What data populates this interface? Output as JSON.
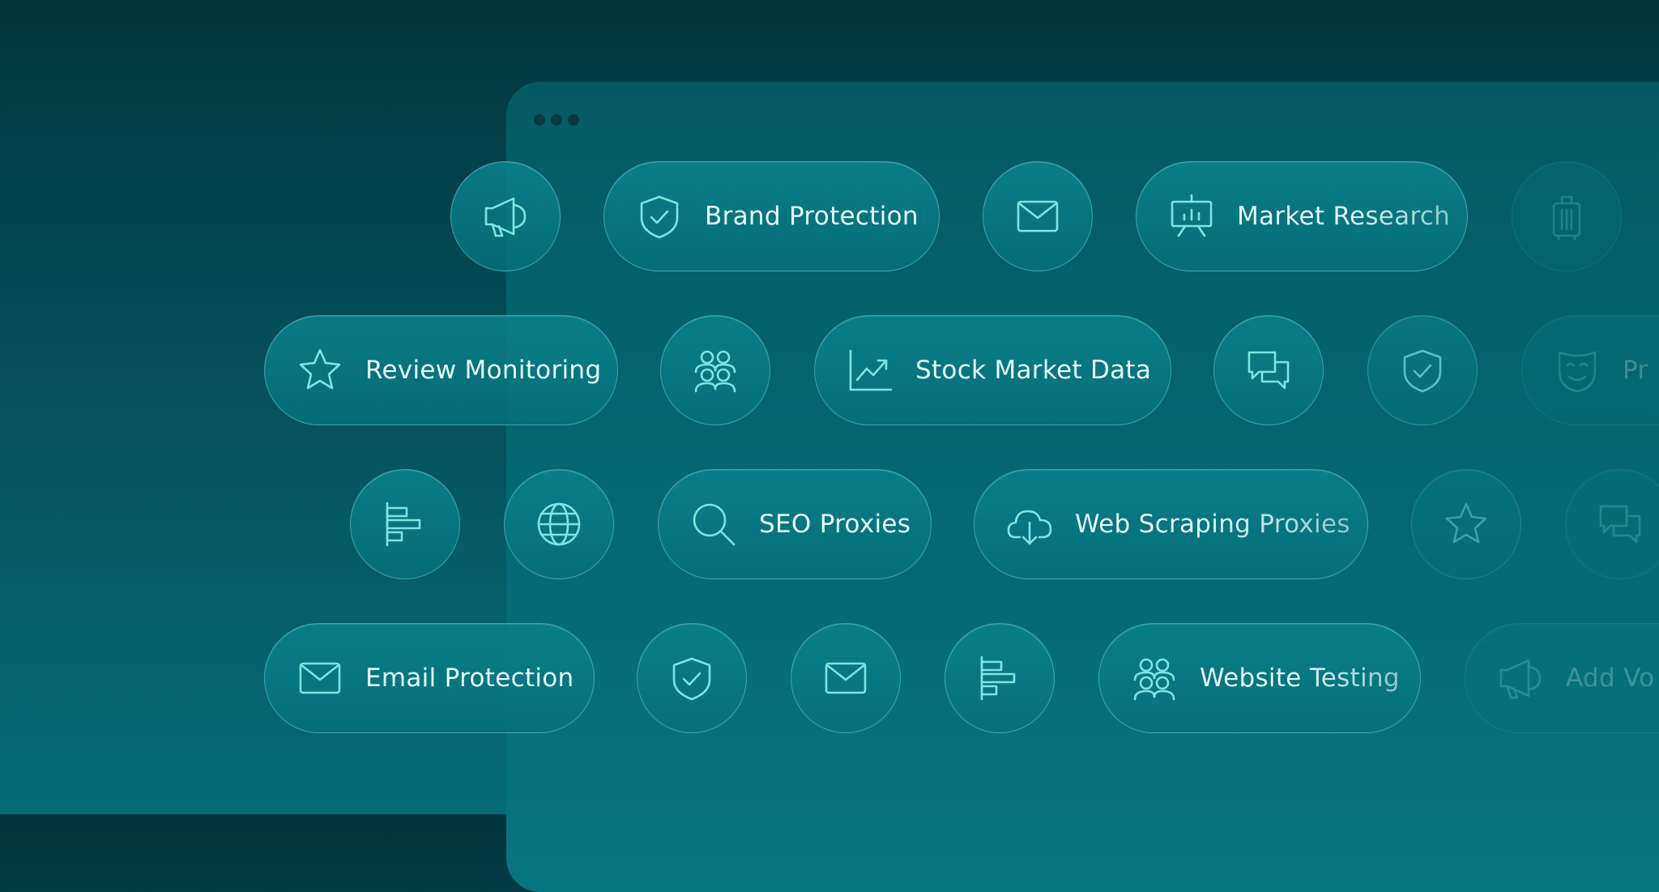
{
  "chips": {
    "brand_protection": "Brand Protection",
    "market_research": "Market Research",
    "review_monitoring": "Review Monitoring",
    "stock_market_data": "Stock Market Data",
    "partial_row2": "Pr",
    "seo_proxies": "SEO Proxies",
    "web_scraping_proxies": "Web Scraping Proxies",
    "email_protection": "Email Protection",
    "website_testing": "Website Testing",
    "add_partial": "Add Vo"
  },
  "icons": [
    "megaphone-icon",
    "shield-check-icon",
    "mail-icon",
    "presentation-chart-icon",
    "luggage-icon",
    "star-icon",
    "users-icon",
    "trend-chart-icon",
    "chat-bubbles-icon",
    "theater-mask-icon",
    "align-bars-icon",
    "globe-icon",
    "search-icon",
    "cloud-download-icon"
  ],
  "colors": {
    "background_top": "#02353d",
    "background_bottom": "#066c77",
    "icon_stroke": "#7fe3e2",
    "label_text": "#e8fbfb"
  }
}
